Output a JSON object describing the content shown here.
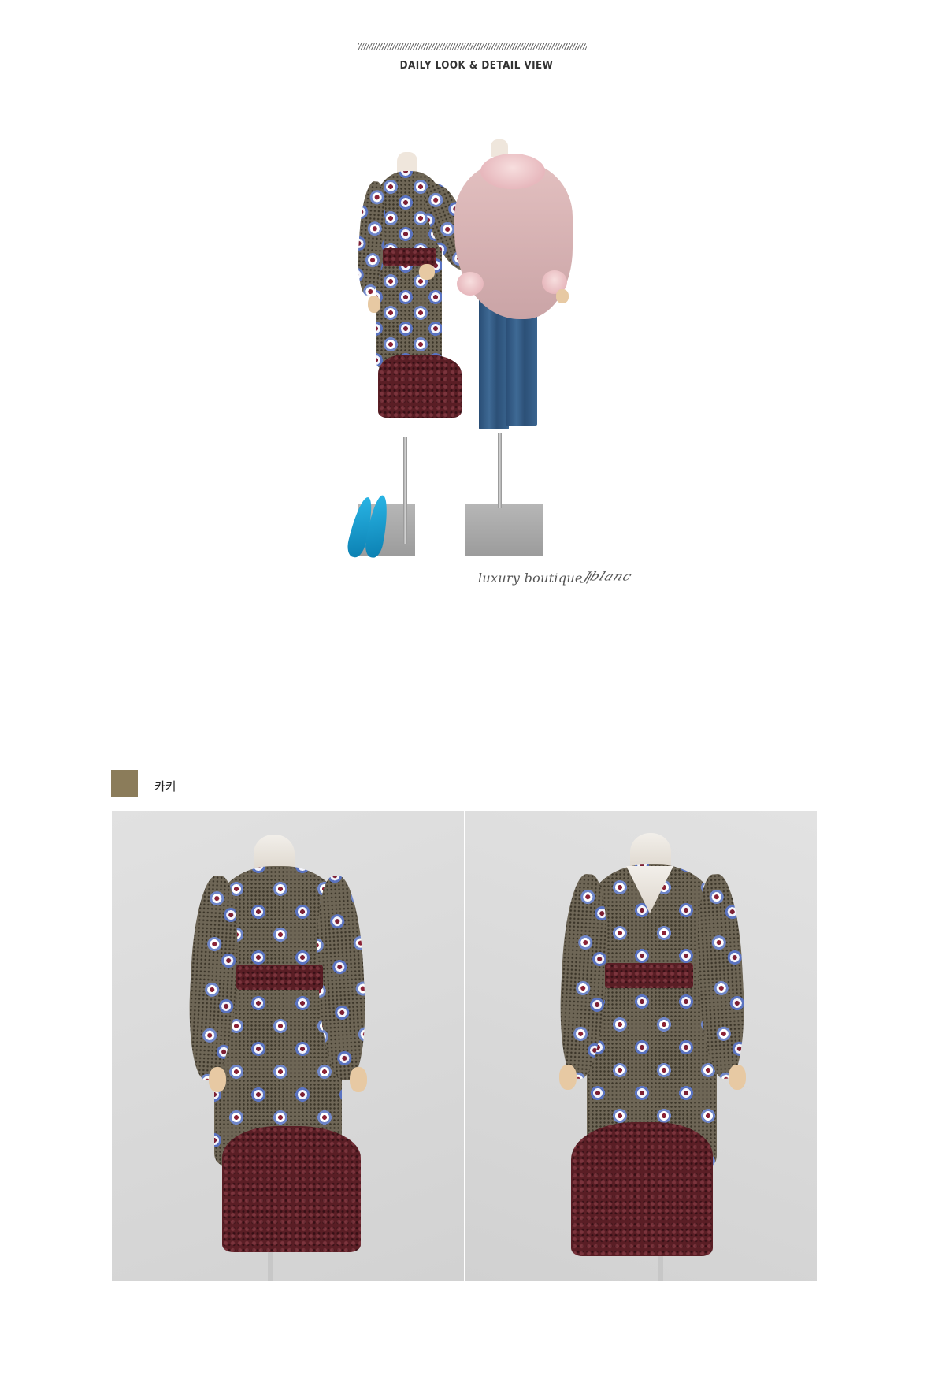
{
  "header": {
    "title": "DAILY LOOK & DETAIL VIEW"
  },
  "daily_look": {
    "caption": "luxury boutique /",
    "signature": "Jblanc"
  },
  "color_option": {
    "swatch_color": "#8b7c5a",
    "name": "카키"
  },
  "palette": {
    "dress_base": "#6e6656",
    "lace": "#5a1e25",
    "cape": "#d8b3b5",
    "jeans": "#34608c",
    "shoes": "#1b9ed0"
  }
}
